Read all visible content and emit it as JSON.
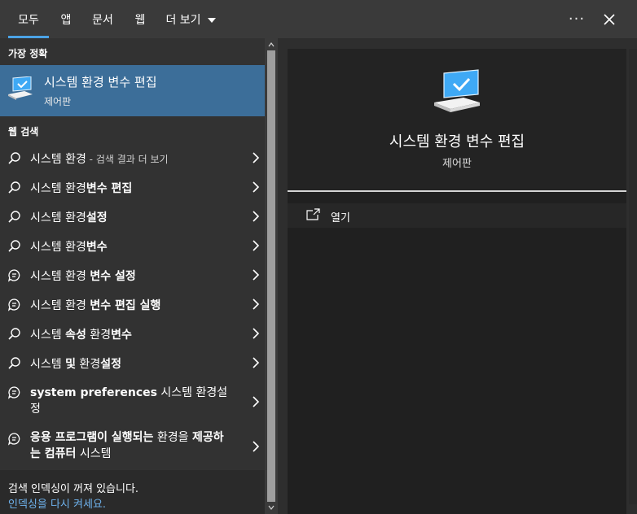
{
  "tabs": [
    {
      "label": "모두",
      "active": true
    },
    {
      "label": "앱",
      "active": false
    },
    {
      "label": "문서",
      "active": false
    },
    {
      "label": "웹",
      "active": false
    }
  ],
  "more_tab": {
    "label": "더 보기"
  },
  "top_actions": {
    "more_options_label": "···",
    "close_icon": "close-icon"
  },
  "left": {
    "best_match_heading": "가장 정확",
    "best_match": {
      "title": "시스템 환경 변수 편집",
      "subtitle": "제어판",
      "icon": "computer-icon"
    },
    "web_heading": "웹 검색",
    "results": [
      {
        "icon": "search-icon",
        "text": "시스템 환경",
        "hint": " - 검색 결과 더 보기"
      },
      {
        "icon": "search-icon",
        "plain": "시스템 환경",
        "bold": "변수 편집"
      },
      {
        "icon": "search-icon",
        "plain": "시스템 환경",
        "bold": "설정"
      },
      {
        "icon": "search-icon",
        "plain": "시스템 환경",
        "bold": "변수"
      },
      {
        "icon": "chat-icon",
        "plain": "시스템 환경 ",
        "bold": "변수 설정"
      },
      {
        "icon": "chat-icon",
        "plain": "시스템 환경 ",
        "bold": "변수 편집 실행"
      },
      {
        "icon": "search-icon",
        "plain": "시스템 ",
        "bold": "속성",
        "plain2": " 환경",
        "bold2": "변수"
      },
      {
        "icon": "search-icon",
        "plain": "시스템 ",
        "bold": "및",
        "plain2": " 환경",
        "bold2": "설정"
      },
      {
        "icon": "chat-icon",
        "bold": "system preferences",
        "plain2": " 시스템 환경설정"
      },
      {
        "icon": "chat-icon",
        "bold": "응용 프로그램이 실행되는",
        "plain2": " 환경을 ",
        "bold2": "제공하는 컴퓨터",
        "plain3": " 시스템"
      }
    ],
    "footer": {
      "line1": "검색 인덱싱이 꺼져 있습니다.",
      "link": "인덱싱을 다시 켜세요."
    }
  },
  "right": {
    "title": "시스템 환경 변수 편집",
    "subtitle": "제어판",
    "action_label": "열기",
    "action_icon": "open-icon"
  },
  "colors": {
    "accent": "#4ba3e6",
    "selected": "#3c6e99",
    "link": "#6fb3ee"
  }
}
